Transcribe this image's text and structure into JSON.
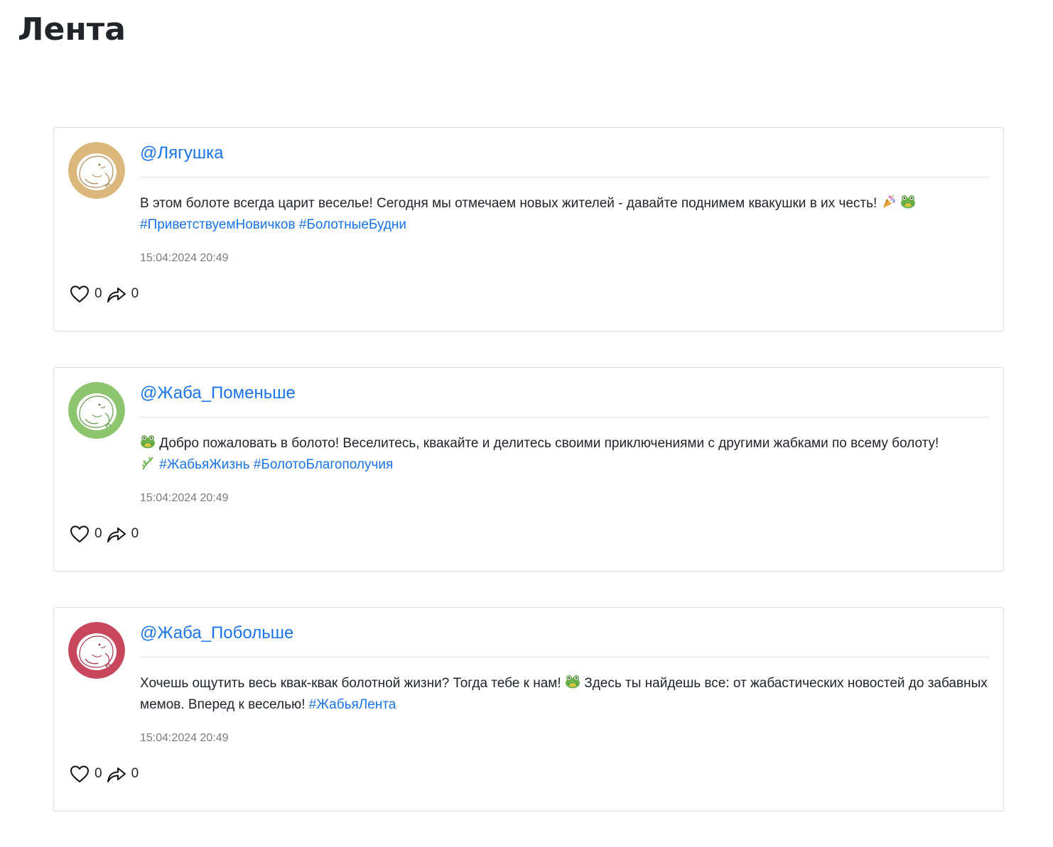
{
  "page": {
    "title": "Лента"
  },
  "colors": {
    "link": "#1a73e8",
    "avatar_1": "#dcb77b",
    "avatar_2": "#8dc46e",
    "avatar_3": "#c9475d",
    "border": "#dcdcdc"
  },
  "icons": {
    "like": "heart-outline-icon",
    "share": "share-arrow-icon",
    "avatar": "frog-sketch-avatar",
    "emoji_party": "party-popper-emoji",
    "emoji_frog": "frog-face-emoji",
    "emoji_herb": "herb-emoji"
  },
  "posts": [
    {
      "author": "@Лягушка",
      "avatar_color": "#dcb77b",
      "text_1": "В этом болоте всегда царит веселье! Сегодня мы отмечаем новых жителей - давайте поднимем квакушки в их честь!",
      "hashtags": "#ПриветствуемНовичков #БолотныеБудни",
      "timestamp": "15:04:2024 20:49",
      "likes": "0",
      "shares": "0"
    },
    {
      "author": "@Жаба_Поменьше",
      "avatar_color": "#8dc46e",
      "text_1": "Добро пожаловать в болото! Веселитесь, квакайте и делитесь своими приключениями с другими жабками по всему болоту!",
      "hashtags": "#ЖабьяЖизнь #БолотоБлагополучия",
      "timestamp": "15:04:2024 20:49",
      "likes": "0",
      "shares": "0"
    },
    {
      "author": "@Жаба_Побольше",
      "avatar_color": "#c9475d",
      "text_1": "Хочешь ощутить весь квак-квак болотной жизни? Тогда тебе к нам!",
      "text_2": "Здесь ты найдешь все: от жабастических новостей до забавных мемов. Вперед к веселью!",
      "hashtags": "#ЖабьяЛента",
      "timestamp": "15:04:2024 20:49",
      "likes": "0",
      "shares": "0"
    }
  ]
}
